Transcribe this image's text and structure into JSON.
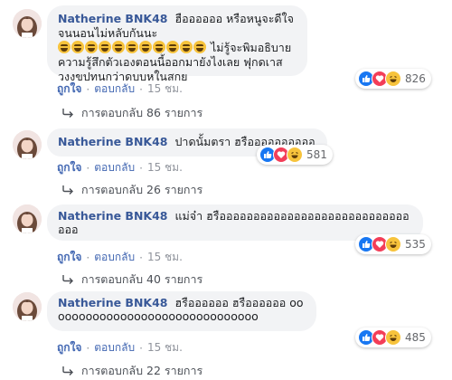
{
  "comments": [
    {
      "author": "Natherine BNK48",
      "text_1": "ฮืออออออ หรือหนูจะดีใจจนนอนไม่หลับกันนะ",
      "emoji_count": "11",
      "text_2": " ไม่รู้จะพิมอธิบายความรู้สึกตัวเองตอนนี้ออกมายังไงเลย ฟุกดเาสวงงขปทนกว่าดบบหในสกย",
      "reactions": [
        "like",
        "love",
        "haha"
      ],
      "reaction_count": "826",
      "like_label": "ถูกใจ",
      "reply_label": "ตอบกลับ",
      "time": "15 ชม.",
      "replies_label": "การตอบกลับ 86 รายการ"
    },
    {
      "author": "Natherine BNK48",
      "text_1": "ปาดนั้มตรา ฮรืออออออออออ",
      "text_2": "",
      "reactions": [
        "like",
        "love",
        "haha"
      ],
      "reaction_count": "581",
      "like_label": "ถูกใจ",
      "reply_label": "ตอบกลับ",
      "time": "15 ชม.",
      "replies_label": "การตอบกลับ 26 รายการ"
    },
    {
      "author": "Natherine BNK48",
      "text_1": "แม่จ๋า ฮรือออออออออออออออออออออออออออออออ",
      "text_2": "",
      "reactions": [
        "like",
        "love",
        "haha"
      ],
      "reaction_count": "535",
      "like_label": "ถูกใจ",
      "reply_label": "ตอบกลับ",
      "time": "15 ชม.",
      "replies_label": "การตอบกลับ 40 รายการ"
    },
    {
      "author": "Natherine BNK48",
      "text_1": "ฮรืออออออ ฮรืออออออ ooooooooooooooooooooooooooooooo",
      "text_2": "",
      "reactions": [
        "like",
        "love",
        "haha"
      ],
      "reaction_count": "485",
      "like_label": "ถูกใจ",
      "reply_label": "ตอบกลับ",
      "time": "15 ชม.",
      "replies_label": "การตอบกลับ 22 รายการ"
    }
  ],
  "colors": {
    "author": "#385898",
    "bubble": "#f2f3f5",
    "link": "#4267b2",
    "meta": "#90949c",
    "like": "#1877f2",
    "love": "#f33e58",
    "haha": "#f7c33c"
  },
  "icons": {
    "reaction_like": "thumbs-up-icon",
    "reaction_love": "heart-icon",
    "reaction_haha": "laughing-face-icon",
    "reply": "reply-arrow-icon",
    "emoji": "crying-laughing-face-icon"
  }
}
